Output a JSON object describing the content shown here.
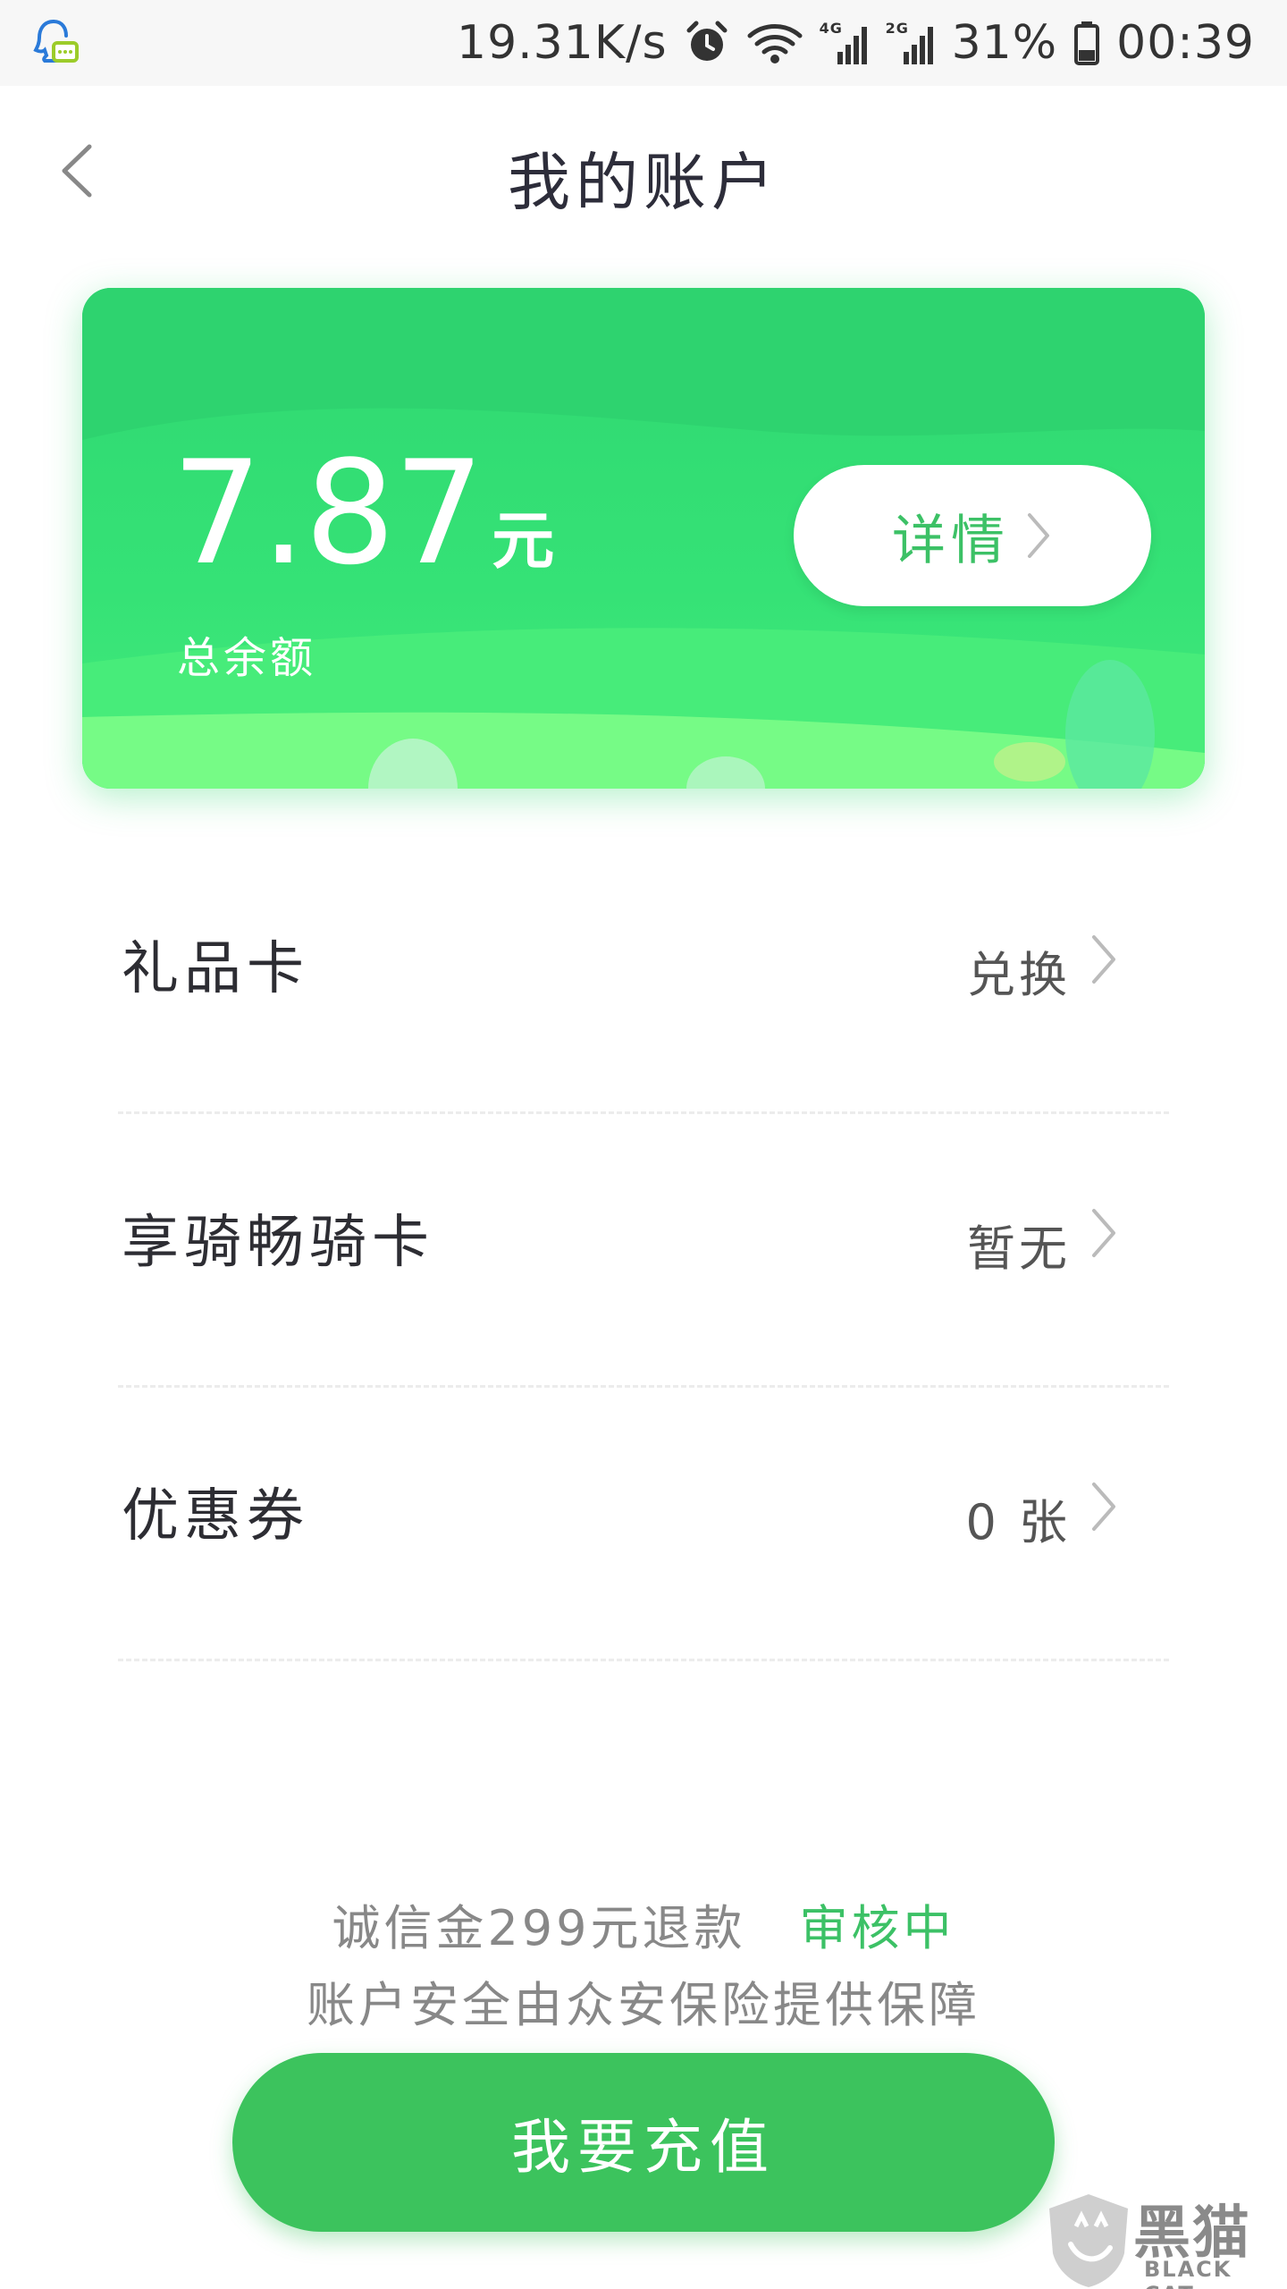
{
  "status_bar": {
    "speed": "19.31K/s",
    "network_4g": "4G",
    "network_2g": "2G",
    "battery": "31%",
    "time": "00:39",
    "icons": [
      "qq-icon",
      "alarm-icon",
      "wifi-icon",
      "signal-icon",
      "battery-icon"
    ]
  },
  "nav": {
    "title": "我的账户",
    "back_icon": "chevron-left-icon"
  },
  "balance_card": {
    "amount": "7.87",
    "unit": "元",
    "label": "总余额",
    "detail_button": "详情"
  },
  "list": {
    "items": [
      {
        "label": "礼品卡",
        "value": "兑换"
      },
      {
        "label": "享骑畅骑卡",
        "value": "暂无"
      },
      {
        "label": "优惠券",
        "value": "0 张"
      }
    ]
  },
  "footer": {
    "deposit_notice": "诚信金299元退款",
    "deposit_status": "审核中",
    "guarantee": "账户安全由众安保险提供保障",
    "recharge_button": "我要充值"
  },
  "watermark": {
    "cn": "黑猫",
    "en": "BLACK CAT"
  },
  "colors": {
    "brand_green": "#3cc35d",
    "card_green": "#35e276",
    "accent_text": "#3cc166"
  }
}
